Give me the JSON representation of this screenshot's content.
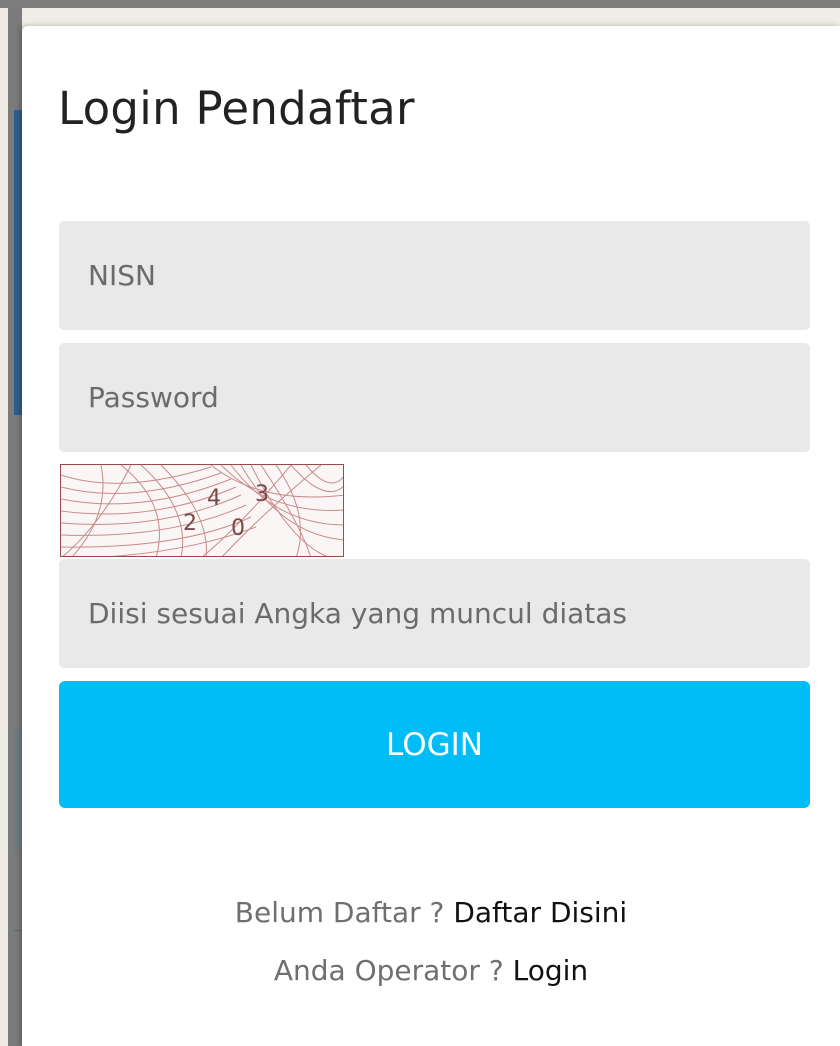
{
  "modal": {
    "title": "Login Pendaftar",
    "fields": {
      "nisn": {
        "value": "",
        "placeholder": "NISN"
      },
      "password": {
        "value": "",
        "placeholder": "Password"
      },
      "captcha_answer": {
        "value": "",
        "placeholder": "Diisi sesuai Angka yang muncul diatas"
      }
    },
    "captcha": {
      "digits": [
        "2",
        "4",
        "0",
        "3"
      ]
    },
    "login_button": {
      "label": "LOGIN"
    },
    "footer": {
      "register_prompt": "Belum Daftar ?",
      "register_link": "Daftar Disini",
      "operator_prompt": "Anda Operator ?",
      "operator_link": "Login"
    }
  },
  "colors": {
    "accent": "#00bdf7",
    "field_bg": "#e9e9e9",
    "captcha_border": "#9b4a4a"
  }
}
